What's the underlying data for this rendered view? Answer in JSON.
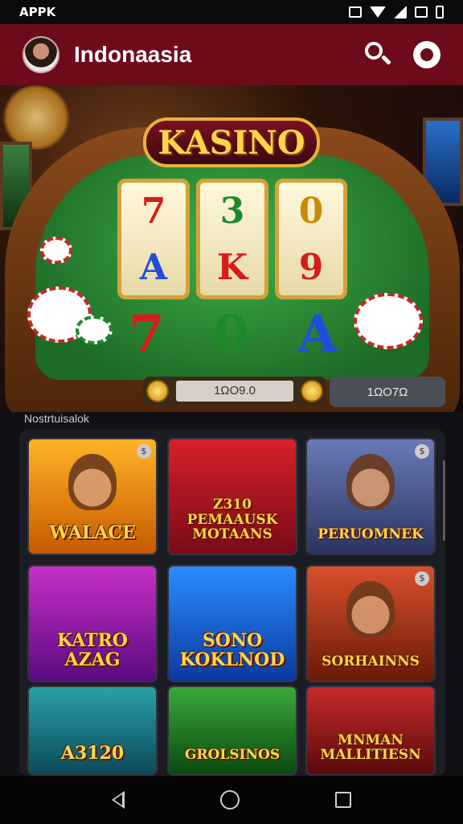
{
  "status_bar": {
    "carrier": "APPK"
  },
  "app_bar": {
    "title": "Indonaasia"
  },
  "hero": {
    "logo_text": "KASINO",
    "reels": [
      [
        "7",
        "A"
      ],
      [
        "3",
        "K"
      ],
      [
        "0",
        "9"
      ]
    ],
    "bottom_symbols": [
      "7",
      "0",
      "A"
    ],
    "input_value": "1ΩO9.0",
    "button_label": "1ΩO7Ω"
  },
  "section": {
    "label": "Nostrtuisalok"
  },
  "games": [
    {
      "title": "WALACE"
    },
    {
      "title": "Z310 PEMAAUSK MOTAANS"
    },
    {
      "title": "PERUOMNEK"
    },
    {
      "title": "KATRO AZAG"
    },
    {
      "title": "SONO KOKLNOD"
    },
    {
      "title": "SORHAINNS"
    },
    {
      "title": "A3120"
    },
    {
      "title": "GROLSINOS"
    },
    {
      "title": "MNMAN MALLITIESN"
    }
  ],
  "colors": {
    "app_bar": "#6e0b1a",
    "accent_gold": "#ffd54a",
    "panel": "#1c1d24"
  },
  "icons": [
    "search-icon",
    "profile-icon",
    "back-icon",
    "home-icon",
    "recents-icon"
  ]
}
